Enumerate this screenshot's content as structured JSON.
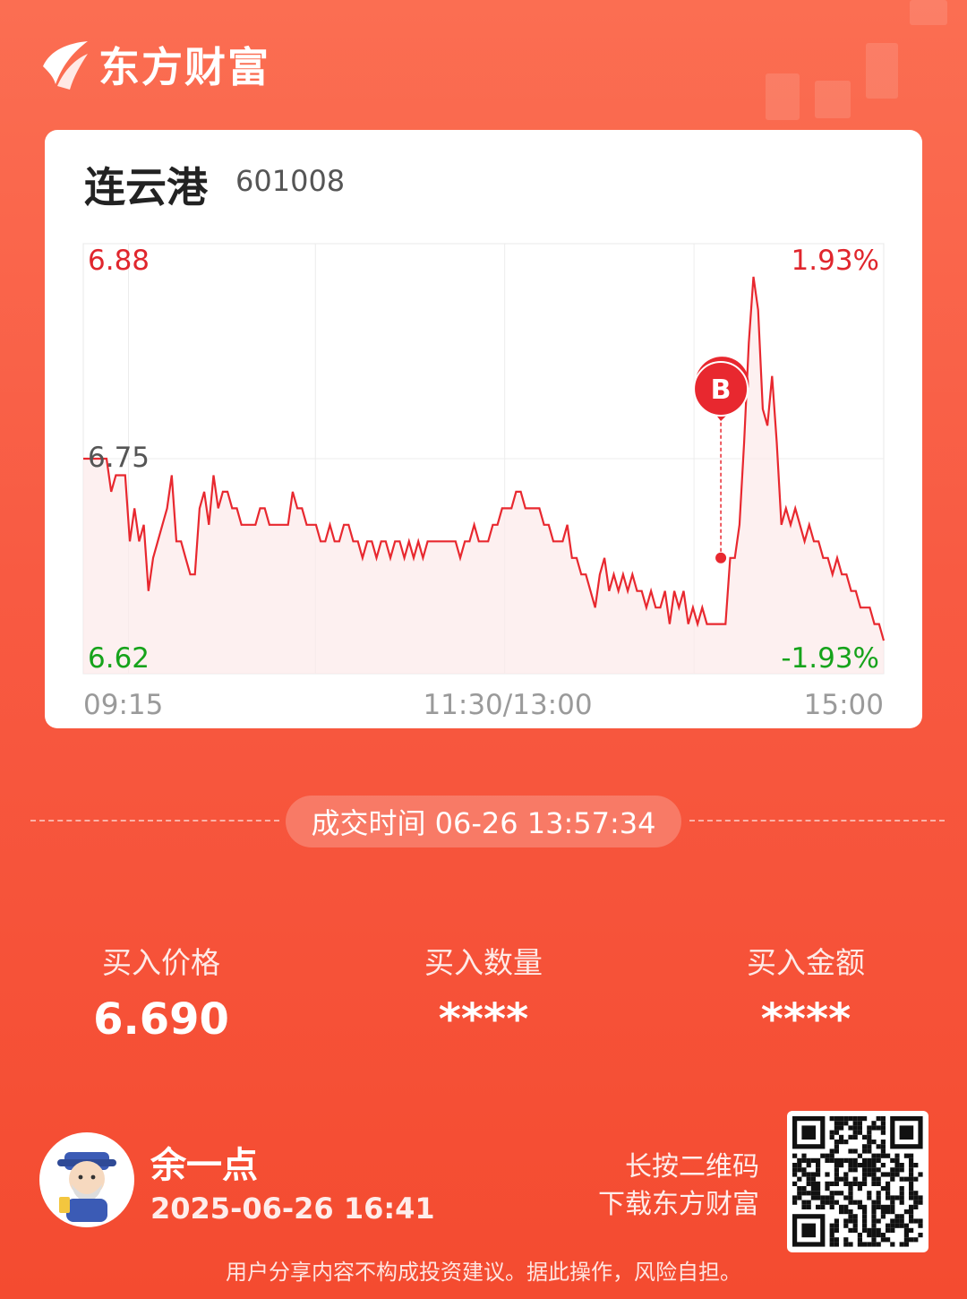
{
  "brand": {
    "name": "东方财富",
    "icon": "east-money-logo-icon"
  },
  "stock": {
    "name": "连云港",
    "code": "601008"
  },
  "chart_labels": {
    "price_high": "6.88",
    "price_mid": "6.75",
    "price_low": "6.62",
    "pct_high": "1.93%",
    "pct_low": "-1.93%",
    "time_start": "09:15",
    "time_mid": "11:30/13:00",
    "time_end": "15:00",
    "marker": "B"
  },
  "chart_data": {
    "type": "line",
    "title": "",
    "xlabel": "",
    "ylabel": "",
    "xticks": [
      "09:15",
      "11:30/13:00",
      "15:00"
    ],
    "ylim": [
      6.62,
      6.88
    ],
    "pct_range": [
      "-1.93%",
      "1.93%"
    ],
    "reference_price": 6.75,
    "grid": true,
    "series": [
      {
        "values": [
          6.75,
          6.75,
          6.75,
          6.75,
          6.75,
          6.75,
          6.73,
          6.74,
          6.74,
          6.74,
          6.7,
          6.72,
          6.7,
          6.71,
          6.67,
          6.69,
          6.7,
          6.71,
          6.72,
          6.74,
          6.7,
          6.7,
          6.69,
          6.68,
          6.68,
          6.72,
          6.73,
          6.71,
          6.74,
          6.72,
          6.73,
          6.73,
          6.72,
          6.72,
          6.71,
          6.71,
          6.71,
          6.71,
          6.72,
          6.72,
          6.71,
          6.71,
          6.71,
          6.71,
          6.71,
          6.73,
          6.72,
          6.72,
          6.71,
          6.71,
          6.71,
          6.7,
          6.7,
          6.71,
          6.7,
          6.7,
          6.71,
          6.71,
          6.7,
          6.7,
          6.69,
          6.7,
          6.7,
          6.69,
          6.7,
          6.7,
          6.69,
          6.7,
          6.7,
          6.69,
          6.7,
          6.69,
          6.7,
          6.69,
          6.7,
          6.7,
          6.7,
          6.7,
          6.7,
          6.7,
          6.7,
          6.69,
          6.7,
          6.7,
          6.71,
          6.7,
          6.7,
          6.7,
          6.71,
          6.71,
          6.72,
          6.72,
          6.72,
          6.73,
          6.73,
          6.72,
          6.72,
          6.72,
          6.72,
          6.71,
          6.71,
          6.7,
          6.7,
          6.7,
          6.71,
          6.69,
          6.69,
          6.68,
          6.68,
          6.67,
          6.66,
          6.68,
          6.69,
          6.67,
          6.68,
          6.67,
          6.68,
          6.67,
          6.68,
          6.67,
          6.67,
          6.66,
          6.67,
          6.66,
          6.66,
          6.67,
          6.65,
          6.67,
          6.66,
          6.67,
          6.65,
          6.66,
          6.65,
          6.66,
          6.65,
          6.65,
          6.65,
          6.65,
          6.65,
          6.69,
          6.69,
          6.71,
          6.76,
          6.82,
          6.86,
          6.84,
          6.78,
          6.77,
          6.8,
          6.76,
          6.71,
          6.72,
          6.71,
          6.72,
          6.71,
          6.7,
          6.71,
          6.7,
          6.7,
          6.69,
          6.69,
          6.68,
          6.69,
          6.68,
          6.68,
          6.67,
          6.67,
          6.66,
          6.66,
          6.66,
          6.65,
          6.65,
          6.64
        ]
      }
    ],
    "markers": [
      {
        "label": "B",
        "price": 6.69,
        "time": "13:57:34"
      }
    ]
  },
  "trade": {
    "time_label": "成交时间 06-26 13:57:34"
  },
  "stats": [
    {
      "label": "买入价格",
      "value": "6.690"
    },
    {
      "label": "买入数量",
      "value": "****"
    },
    {
      "label": "买入金额",
      "value": "****"
    }
  ],
  "user": {
    "name": "余一点",
    "time": "2025-06-26 16:41",
    "avatar_icon": "cartoon-god-of-wealth-avatar"
  },
  "qr": {
    "hint_line1": "长按二维码",
    "hint_line2": "下载东方财富",
    "icon": "qr-code-icon"
  },
  "disclaimer": "用户分享内容不构成投资建议。据此操作，风险自担。",
  "colors": {
    "up": "#e0262d",
    "down": "#16a31b",
    "background": "#f85a42",
    "line": "#e8282f"
  }
}
